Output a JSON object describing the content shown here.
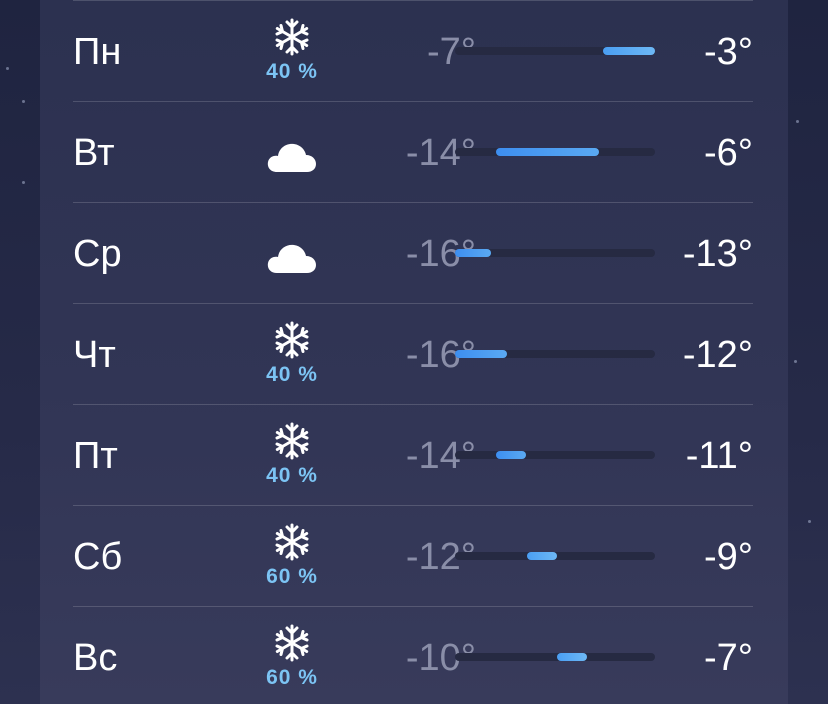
{
  "colors": {
    "precip": "#7cc4f4",
    "bar_track": "#262a42",
    "bar_fill": "#3d8ef0",
    "low_text": "#8a8ea8",
    "high_text": "#ffffff"
  },
  "scale": {
    "min": -16,
    "max": -3
  },
  "forecast": [
    {
      "day": "Пн",
      "icon": "snowflake-icon",
      "precip": "40 %",
      "low": "-7°",
      "high": "-3°",
      "range": [
        -7,
        -3
      ]
    },
    {
      "day": "Вт",
      "icon": "cloud-icon",
      "precip": "",
      "low": "-14°",
      "high": "-6°",
      "range": [
        -14,
        -6
      ]
    },
    {
      "day": "Ср",
      "icon": "cloud-icon",
      "precip": "",
      "low": "-16°",
      "high": "-13°",
      "range": [
        -16,
        -13
      ]
    },
    {
      "day": "Чт",
      "icon": "snowflake-icon",
      "precip": "40 %",
      "low": "-16°",
      "high": "-12°",
      "range": [
        -16,
        -12
      ]
    },
    {
      "day": "Пт",
      "icon": "snowflake-icon",
      "precip": "40 %",
      "low": "-14°",
      "high": "-11°",
      "range": [
        -14,
        -11
      ]
    },
    {
      "day": "Сб",
      "icon": "snowflake-icon",
      "precip": "60 %",
      "low": "-12°",
      "high": "-9°",
      "range": [
        -12,
        -9
      ]
    },
    {
      "day": "Вс",
      "icon": "snowflake-icon",
      "precip": "60 %",
      "low": "-10°",
      "high": "-7°",
      "range": [
        -10,
        -7
      ]
    }
  ]
}
